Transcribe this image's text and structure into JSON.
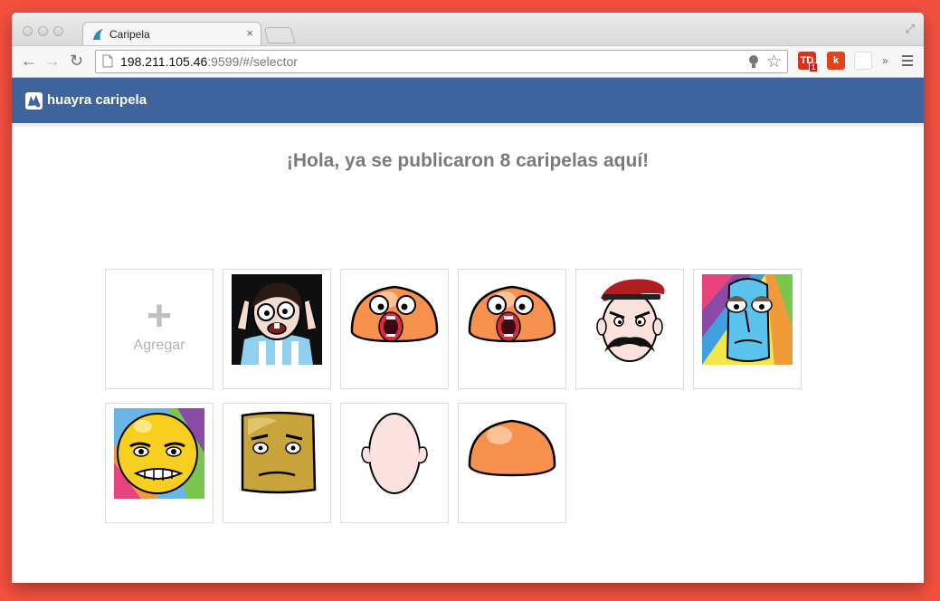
{
  "browser": {
    "tab_title": "Caripela",
    "tab_close": "×",
    "url_host": "198.211.105.46",
    "url_rest": ":9599/#/selector",
    "extension_badge": "1",
    "extension_k": "k",
    "chevron": "»"
  },
  "app": {
    "name": "huayra caripela",
    "accent_color": "#3d649d",
    "headline": "¡Hola, ya se publicaron 8 caripelas aquí!"
  },
  "selector": {
    "add_label": "Agregar",
    "add_icon": "plus-icon",
    "items": [
      {
        "icon": "caripela-soccer-fan-icon"
      },
      {
        "icon": "caripela-orange-blob-lips-icon"
      },
      {
        "icon": "caripela-orange-blob-lips-icon"
      },
      {
        "icon": "caripela-mustache-beret-icon"
      },
      {
        "icon": "caripela-blue-rainbow-icon"
      },
      {
        "icon": "caripela-yellow-rainbow-icon"
      },
      {
        "icon": "caripela-golden-square-icon"
      },
      {
        "icon": "caripela-blank-head-icon"
      },
      {
        "icon": "caripela-orange-blob-icon"
      }
    ]
  }
}
